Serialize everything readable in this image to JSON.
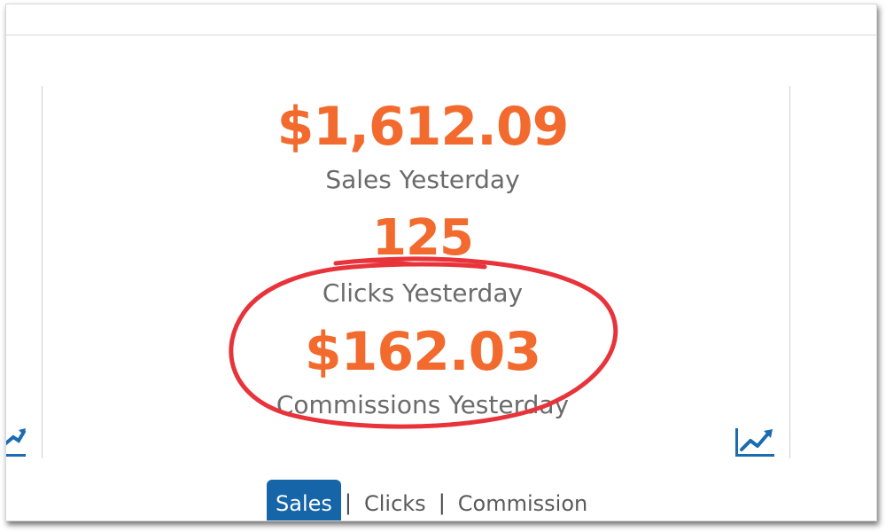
{
  "stats": {
    "sales": {
      "value": "$1,612.09",
      "label": "Sales Yesterday"
    },
    "clicks": {
      "value": "125",
      "label": "Clicks Yesterday"
    },
    "commissions": {
      "value": "$162.03",
      "label": "Commissions Yesterday"
    }
  },
  "tabs": [
    {
      "label": "Sales",
      "active": true
    },
    {
      "label": "Clicks",
      "active": false
    },
    {
      "label": "Commission",
      "active": false
    }
  ],
  "separator": "|",
  "icons": {
    "chart": "trend-up-chart-icon"
  },
  "colors": {
    "accent_orange": "#F26A2E",
    "label_gray": "#6b6b6b",
    "tab_active_bg": "#1565a8",
    "tab_text": "#5a5a5a",
    "annotation_red": "#e8333a",
    "icon_blue": "#1a6bb0"
  }
}
